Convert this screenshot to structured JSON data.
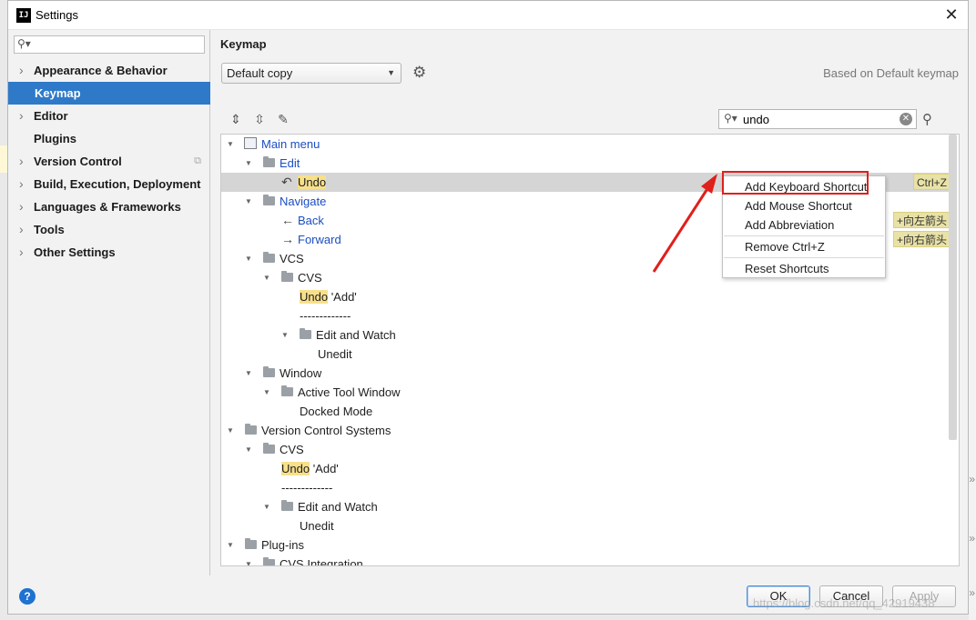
{
  "window": {
    "title": "Settings",
    "app_icon": "intellij-icon"
  },
  "sidebar": {
    "search_placeholder": "",
    "items": [
      {
        "label": "Appearance & Behavior",
        "expandable": true
      },
      {
        "label": "Keymap",
        "expandable": false,
        "selected": true
      },
      {
        "label": "Editor",
        "expandable": true
      },
      {
        "label": "Plugins",
        "expandable": false
      },
      {
        "label": "Version Control",
        "expandable": true
      },
      {
        "label": "Build, Execution, Deployment",
        "expandable": true
      },
      {
        "label": "Languages & Frameworks",
        "expandable": true
      },
      {
        "label": "Tools",
        "expandable": true
      },
      {
        "label": "Other Settings",
        "expandable": true
      }
    ]
  },
  "main": {
    "title": "Keymap",
    "keymap_select": "Default copy",
    "based_on": "Based on Default keymap",
    "search_value": "undo"
  },
  "tree": [
    {
      "indent": 0,
      "expanded": true,
      "icon": "menu",
      "label": "Main menu",
      "blue": true
    },
    {
      "indent": 1,
      "expanded": true,
      "icon": "folder",
      "label": "Edit",
      "blue": true
    },
    {
      "indent": 2,
      "icon": "undo-arrow",
      "label": "Undo",
      "highlight": true,
      "selected": true,
      "shortcut": "Ctrl+Z"
    },
    {
      "indent": 1,
      "expanded": true,
      "icon": "folder",
      "label": "Navigate",
      "blue": true
    },
    {
      "indent": 2,
      "icon": "back-arrow",
      "label": "Back",
      "blue": true,
      "shortcut": "+向左箭头"
    },
    {
      "indent": 2,
      "icon": "forward-arrow",
      "label": "Forward",
      "blue": true,
      "shortcut": "+向右箭头"
    },
    {
      "indent": 1,
      "expanded": true,
      "icon": "folder",
      "label": "VCS"
    },
    {
      "indent": 2,
      "expanded": true,
      "icon": "folder",
      "label": "CVS"
    },
    {
      "indent": 3,
      "label": "Undo",
      "highlight": true,
      "suffix": " 'Add'"
    },
    {
      "indent": 3,
      "label": "-------------"
    },
    {
      "indent": 3,
      "expanded": true,
      "icon": "folder",
      "label": "Edit and Watch",
      "shift_left": true
    },
    {
      "indent": 4,
      "label": "Unedit"
    },
    {
      "indent": 1,
      "expanded": true,
      "icon": "folder",
      "label": "Window"
    },
    {
      "indent": 2,
      "expanded": true,
      "icon": "folder",
      "label": "Active Tool Window"
    },
    {
      "indent": 3,
      "label": "Docked Mode"
    },
    {
      "indent": 0,
      "expanded": true,
      "icon": "folder",
      "label": "Version Control Systems"
    },
    {
      "indent": 1,
      "expanded": true,
      "icon": "folder",
      "label": "CVS"
    },
    {
      "indent": 2,
      "label": "Undo",
      "highlight": true,
      "suffix": " 'Add'"
    },
    {
      "indent": 2,
      "label": "-------------"
    },
    {
      "indent": 2,
      "expanded": true,
      "icon": "folder",
      "label": "Edit and Watch",
      "shift_left": true
    },
    {
      "indent": 3,
      "label": "Unedit"
    },
    {
      "indent": 0,
      "expanded": true,
      "icon": "folder",
      "label": "Plug-ins"
    },
    {
      "indent": 1,
      "expanded": true,
      "icon": "folder",
      "label": "CVS Integration"
    }
  ],
  "context_menu": {
    "items": [
      "Add Keyboard Shortcut",
      "Add Mouse Shortcut",
      "Add Abbreviation",
      "Remove Ctrl+Z",
      "Reset Shortcuts"
    ]
  },
  "buttons": {
    "ok": "OK",
    "cancel": "Cancel",
    "apply": "Apply",
    "help": "?"
  },
  "watermark": "https://blog.csdn.net/qq_42919438",
  "colors": {
    "selection": "#2e7ac9",
    "link": "#1b4ec2",
    "highlight": "#f7e08c",
    "annotation": "#e0201b"
  }
}
